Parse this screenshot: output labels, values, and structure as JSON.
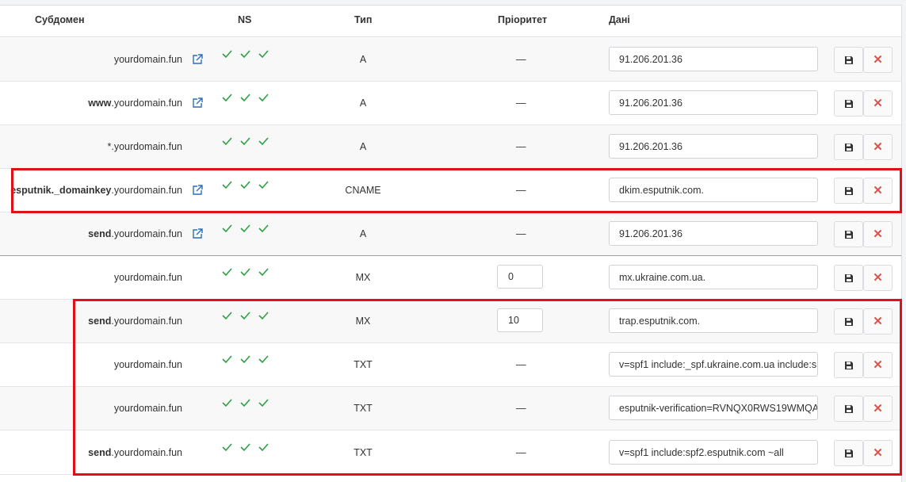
{
  "header": {
    "subdomain": "Субдомен",
    "ns": "NS",
    "type": "Тип",
    "priority": "Пріоритет",
    "data": "Дані"
  },
  "rows": [
    {
      "sub_bold": "",
      "sub_rest": "yourdomain.fun",
      "link": true,
      "type": "A",
      "priority": "",
      "data": "91.206.201.36"
    },
    {
      "sub_bold": "www",
      "sub_rest": ".yourdomain.fun",
      "link": true,
      "type": "A",
      "priority": "",
      "data": "91.206.201.36"
    },
    {
      "sub_bold": "",
      "sub_rest": "*.yourdomain.fun",
      "link": false,
      "type": "A",
      "priority": "",
      "data": "91.206.201.36"
    },
    {
      "sub_bold": "esputnik._domainkey",
      "sub_rest": ".yourdomain.fun",
      "link": true,
      "type": "CNAME",
      "priority": "",
      "data": "dkim.esputnik.com."
    },
    {
      "sub_bold": "send",
      "sub_rest": ".yourdomain.fun",
      "link": true,
      "type": "A",
      "priority": "",
      "data": "91.206.201.36"
    },
    {
      "sub_bold": "",
      "sub_rest": "yourdomain.fun",
      "link": false,
      "type": "MX",
      "priority": "0",
      "data": "mx.ukraine.com.ua."
    },
    {
      "sub_bold": "send",
      "sub_rest": ".yourdomain.fun",
      "link": false,
      "type": "MX",
      "priority": "10",
      "data": "trap.esputnik.com."
    },
    {
      "sub_bold": "",
      "sub_rest": "yourdomain.fun",
      "link": false,
      "type": "TXT",
      "priority": "",
      "data": "v=spf1 include:_spf.ukraine.com.ua include:s"
    },
    {
      "sub_bold": "",
      "sub_rest": "yourdomain.fun",
      "link": false,
      "type": "TXT",
      "priority": "",
      "data": "esputnik-verification=RVNQX0RWS19WMQA"
    },
    {
      "sub_bold": "send",
      "sub_rest": ".yourdomain.fun",
      "link": false,
      "type": "TXT",
      "priority": "",
      "data": "v=spf1 include:spf2.esputnik.com ~all"
    }
  ],
  "empty_priority": "—",
  "icons": {
    "link": "external-link-icon",
    "ns": "check-icon",
    "save": "floppy-disk-icon",
    "delete": "close-icon"
  },
  "colors": {
    "check": "#2ea043",
    "link": "#2a6ebb",
    "delete": "#d9534f",
    "highlight": "#e0101a"
  }
}
